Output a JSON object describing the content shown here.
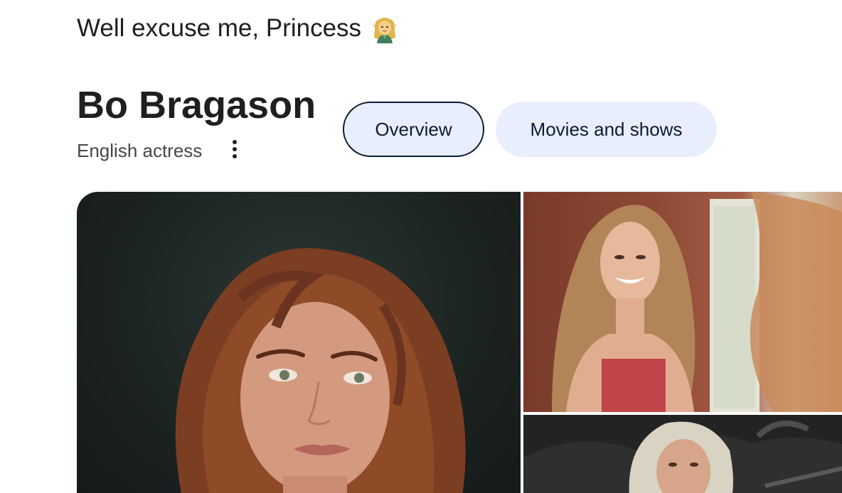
{
  "banner": {
    "heading": "Well excuse me, Princess",
    "emoji_icon": "elf-woman-emoji"
  },
  "entity": {
    "name": "Bo Bragason",
    "description": "English actress",
    "more_icon": "more-vert-icon"
  },
  "tabs": [
    {
      "label": "Overview",
      "selected": true
    },
    {
      "label": "Movies and shows",
      "selected": false
    }
  ],
  "colors": {
    "chip_bg": "#e8eefb",
    "chip_border": "#0b1c33",
    "text": "#1f1f1f",
    "subtext": "#474747"
  },
  "images": [
    {
      "name": "portrait-photo"
    },
    {
      "name": "smiling-photo"
    },
    {
      "name": "bonnet-photo"
    }
  ]
}
